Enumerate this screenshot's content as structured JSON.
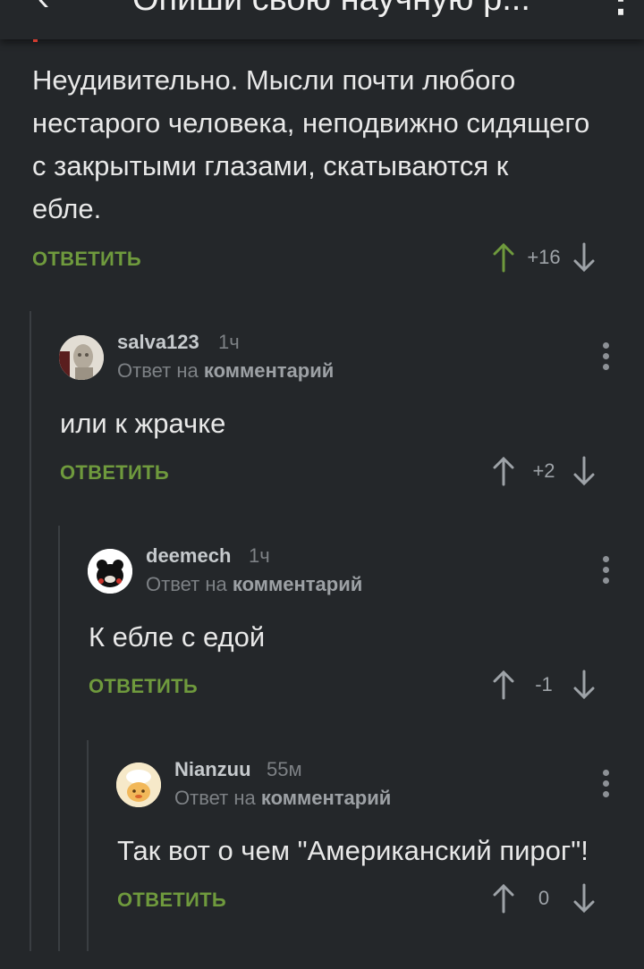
{
  "header": {
    "back_icon": "‹",
    "title": "Опиши свою научную р...",
    "menu_icon": "⋮"
  },
  "root_comment": {
    "text_lines": [
      "Неудивительно. Мысли почти любого",
      "нестарого человека, неподвижно сидящего",
      "с закрытыми глазами, скатываются к",
      "ебле."
    ],
    "reply_label": "ОТВЕТИТЬ",
    "score": "+16"
  },
  "comments": [
    {
      "username": "salva123",
      "time": "1ч",
      "reply_to_prefix": "Ответ на",
      "reply_to_target": "комментарий",
      "text": "или к жрачке",
      "reply_label": "ОТВЕТИТЬ",
      "score": "+2"
    },
    {
      "username": "deemech",
      "time": "1ч",
      "reply_to_prefix": "Ответ на",
      "reply_to_target": "комментарий",
      "text": "К ебле с едой",
      "reply_label": "ОТВЕТИТЬ",
      "score": "-1"
    },
    {
      "username": "Nianzuu",
      "time": "55м",
      "reply_to_prefix": "Ответ на",
      "reply_to_target": "комментарий",
      "text": "Так вот о чем \"Американский пирог\"!",
      "reply_label": "ОТВЕТИТЬ",
      "score": "0"
    }
  ],
  "colors": {
    "background": "#24272a",
    "reply_green": "#6f9a3d",
    "upvoted_green": "#6f9a3d",
    "arrow_gray": "#9ea3a8"
  }
}
